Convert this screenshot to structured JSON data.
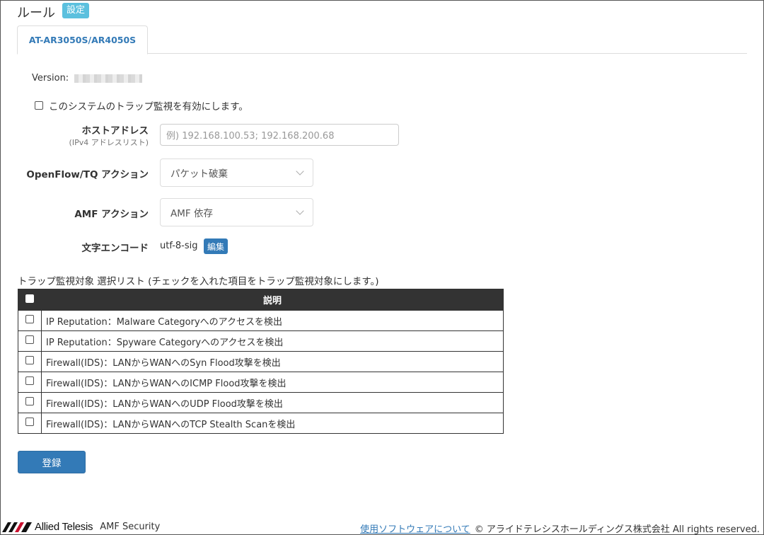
{
  "page": {
    "title": "ルール",
    "badge": "設定"
  },
  "tabs": [
    {
      "label": "AT-AR3050S/AR4050S",
      "active": true
    }
  ],
  "version": {
    "label": "Version:"
  },
  "enable": {
    "label": "このシステムのトラップ監視を有効にします。",
    "checked": false
  },
  "form": {
    "host": {
      "label": "ホストアドレス",
      "sublabel": "(IPv4 アドレスリスト)",
      "placeholder": "例) 192.168.100.53; 192.168.200.68"
    },
    "openflow": {
      "label": "OpenFlow/TQ アクション",
      "value": "パケット破棄"
    },
    "amf": {
      "label": "AMF アクション",
      "value": "AMF 依存"
    },
    "encode": {
      "label": "文字エンコード",
      "value": "utf-8-sig",
      "edit_label": "編集"
    }
  },
  "trap_list": {
    "caption": "トラップ監視対象 選択リスト (チェックを入れた項目をトラップ監視対象にします。)",
    "header": "説明",
    "rows": [
      "IP Reputation：Malware Categoryへのアクセスを検出",
      "IP Reputation：Spyware Categoryへのアクセスを検出",
      "Firewall(IDS)：LANからWANへのSyn Flood攻撃を検出",
      "Firewall(IDS)：LANからWANへのICMP Flood攻撃を検出",
      "Firewall(IDS)：LANからWANへのUDP Flood攻撃を検出",
      "Firewall(IDS)：LANからWANへのTCP Stealth Scanを検出"
    ]
  },
  "actions": {
    "register": "登録"
  },
  "footer": {
    "brand": "Allied Telesis",
    "product": "AMF Security",
    "link": "使用ソフトウェアについて",
    "copyright": "© アライドテレシスホールディングス株式会社 All rights reserved."
  },
  "colors": {
    "primary": "#337ab7",
    "info": "#5bc0de",
    "table_header": "#333333"
  }
}
